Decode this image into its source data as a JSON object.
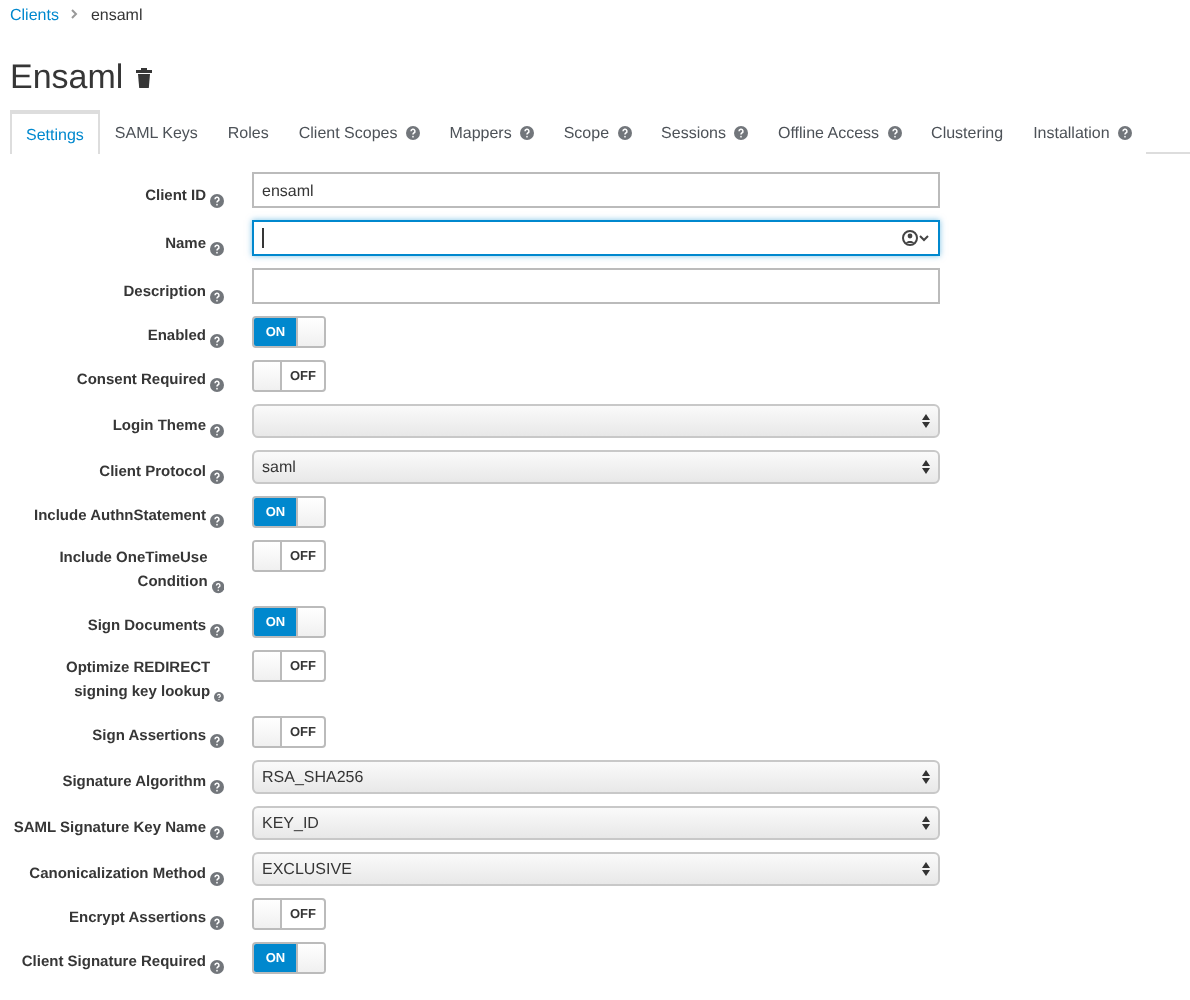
{
  "breadcrumb": [
    {
      "label": "Clients",
      "link": true
    },
    {
      "label": "ensaml",
      "link": false
    }
  ],
  "title": "Ensaml",
  "tabs": [
    {
      "label": "Settings",
      "selected": true,
      "help": false
    },
    {
      "label": "SAML Keys",
      "selected": false,
      "help": false
    },
    {
      "label": "Roles",
      "selected": false,
      "help": false
    },
    {
      "label": "Client Scopes",
      "selected": false,
      "help": true
    },
    {
      "label": "Mappers",
      "selected": false,
      "help": true
    },
    {
      "label": "Scope",
      "selected": false,
      "help": true
    },
    {
      "label": "Sessions",
      "selected": false,
      "help": true
    },
    {
      "label": "Offline Access",
      "selected": false,
      "help": true
    },
    {
      "label": "Clustering",
      "selected": false,
      "help": false
    },
    {
      "label": "Installation",
      "selected": false,
      "help": true
    }
  ],
  "fields": [
    {
      "kind": "text",
      "label": "Client ID",
      "value": "ensaml",
      "focused": false
    },
    {
      "kind": "text",
      "label": "Name",
      "focused": true
    },
    {
      "kind": "text",
      "label": "Description",
      "focused": false
    },
    {
      "kind": "switch",
      "label": "Enabled",
      "on": true,
      "text": "ON"
    },
    {
      "kind": "switch",
      "label": "Consent Required",
      "on": false,
      "text": "OFF"
    },
    {
      "kind": "select",
      "label": "Login Theme"
    },
    {
      "kind": "select",
      "label": "Client Protocol",
      "value": "saml"
    },
    {
      "kind": "switch",
      "label": "Include AuthnStatement",
      "on": true,
      "text": "ON"
    },
    {
      "kind": "switch",
      "label": "Include OneTimeUse Condition",
      "on": false,
      "text": "OFF"
    },
    {
      "kind": "switch",
      "label": "Sign Documents",
      "on": true,
      "text": "ON"
    },
    {
      "kind": "switch",
      "label": "Optimize REDIRECT signing key lookup",
      "on": false,
      "text": "OFF"
    },
    {
      "kind": "switch",
      "label": "Sign Assertions",
      "on": false,
      "text": "OFF"
    },
    {
      "kind": "select",
      "label": "Signature Algorithm",
      "value": "RSA_SHA256"
    },
    {
      "kind": "select",
      "label": "SAML Signature Key Name",
      "value": "KEY_ID"
    },
    {
      "kind": "select",
      "label": "Canonicalization Method",
      "value": "EXCLUSIVE"
    },
    {
      "kind": "switch",
      "label": "Encrypt Assertions",
      "on": false,
      "text": "OFF"
    },
    {
      "kind": "switch",
      "label": "Client Signature Required",
      "on": true,
      "text": "ON"
    }
  ]
}
